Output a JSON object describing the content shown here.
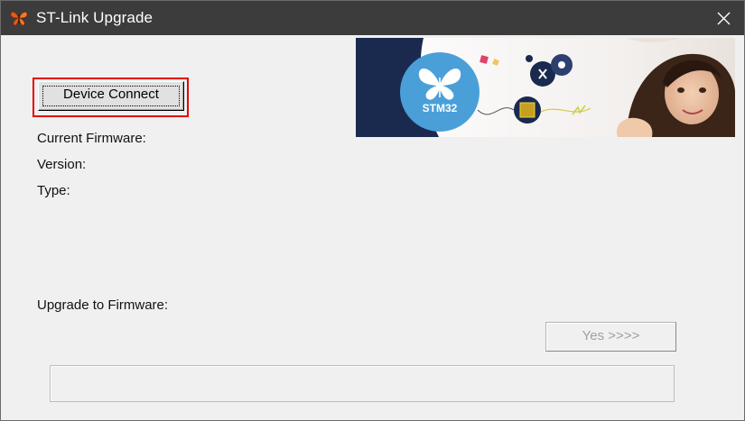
{
  "window": {
    "title": "ST-Link Upgrade"
  },
  "buttons": {
    "device_connect": "Device Connect",
    "yes": "Yes >>>>"
  },
  "labels": {
    "current_firmware": "Current Firmware:",
    "version": "Version:",
    "type": "Type:",
    "upgrade_to_firmware": "Upgrade to Firmware:"
  },
  "banner": {
    "logo_text": "STM32"
  },
  "progress": {
    "value": 0
  },
  "colors": {
    "title_bar": "#3c3c3c",
    "focus_border": "#e60000",
    "banner_navy": "#1a2a4e",
    "banner_blue": "#4a9fd9"
  },
  "icons": {
    "app": "butterfly-icon",
    "close": "close-icon"
  }
}
